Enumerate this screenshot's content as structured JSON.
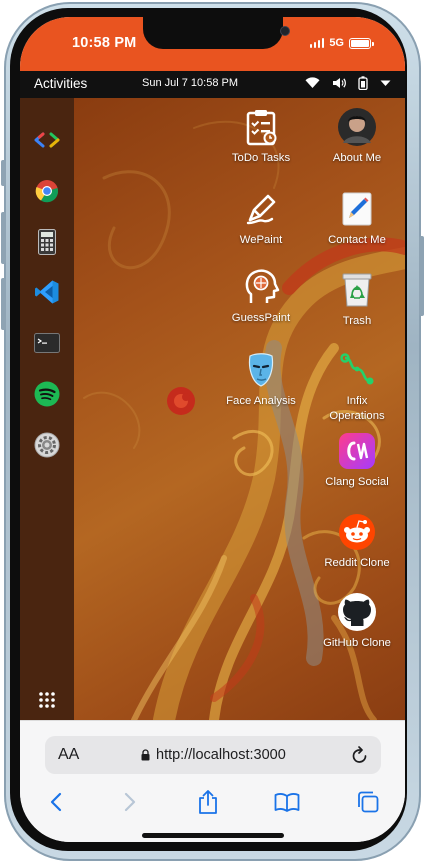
{
  "ios": {
    "time": "10:58 PM",
    "network": "5G"
  },
  "topbar": {
    "activities": "Activities",
    "datetime": "Sun Jul 7 10:58 PM"
  },
  "dock": [
    {
      "name": "vscode-remote-icon"
    },
    {
      "name": "chrome-icon"
    },
    {
      "name": "calculator-icon"
    },
    {
      "name": "vscode-icon"
    },
    {
      "name": "terminal-icon"
    },
    {
      "name": "spotify-icon"
    },
    {
      "name": "settings-icon"
    },
    {
      "name": "show-apps-icon"
    }
  ],
  "apps": {
    "todo": "ToDo Tasks",
    "about": "About Me",
    "wepaint": "WePaint",
    "contact": "Contact Me",
    "guesspaint": "GuessPaint",
    "trash": "Trash",
    "face": "Face Analysis",
    "infix": "Infix\nOperations",
    "clang": "Clang Social",
    "reddit": "Reddit Clone",
    "github": "GitHub Clone"
  },
  "safari": {
    "url": "http://localhost:3000",
    "text_size_label": "AA"
  },
  "colors": {
    "accent": "#e95420",
    "topbar": "#111111",
    "dock": "#4a2510"
  }
}
